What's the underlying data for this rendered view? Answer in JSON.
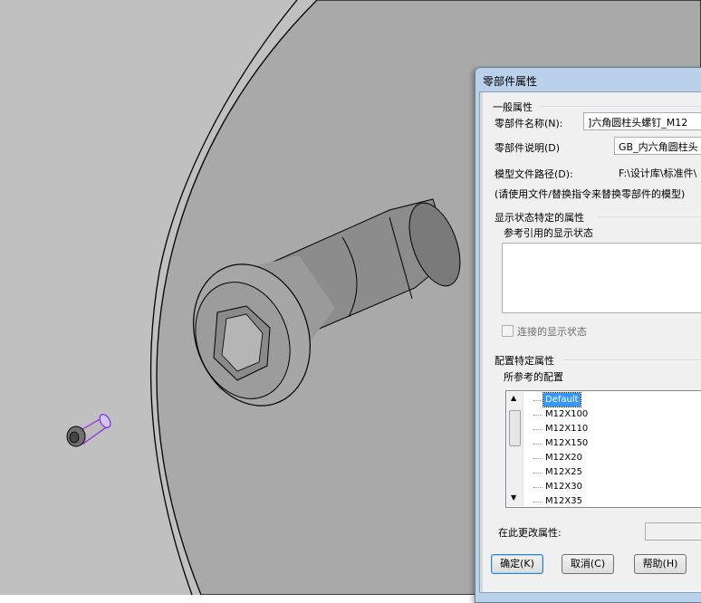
{
  "dialog": {
    "title": "零部件属性",
    "general": {
      "legend": "一般属性",
      "name_label": "零部件名称(N):",
      "name_value": "]六角圆柱头螺钉_M12",
      "desc_label": "零部件说明(D)",
      "desc_value": "GB_内六角圆柱头",
      "path_label": "模型文件路径(D):",
      "path_value": "F:\\设计库\\标准件\\",
      "note": "(请使用文件/替换指令来替换零部件的模型)"
    },
    "display": {
      "legend": "显示状态特定的属性",
      "sub_legend": "参考引用的显示状态",
      "linked_checkbox_label": "连接的显示状态",
      "linked_checked": false
    },
    "config": {
      "legend": "配置特定属性",
      "sub_legend": "所参考的配置",
      "items": [
        "Default",
        "M12X100",
        "M12X110",
        "M12X150",
        "M12X20",
        "M12X25",
        "M12X30",
        "M12X35"
      ],
      "selected": "Default",
      "change_label": "在此更改属性:"
    },
    "buttons": {
      "ok": "确定(K)",
      "cancel": "取消(C)",
      "help": "帮助(H)"
    }
  },
  "colors": {
    "viewport_bg": "#c0c0c0",
    "plate": "#a8a8a8",
    "bolt": "#8f8f8f",
    "highlight": "#8a2be2",
    "dialog_frame": "#b9d1ea",
    "selection": "#3399ff"
  }
}
